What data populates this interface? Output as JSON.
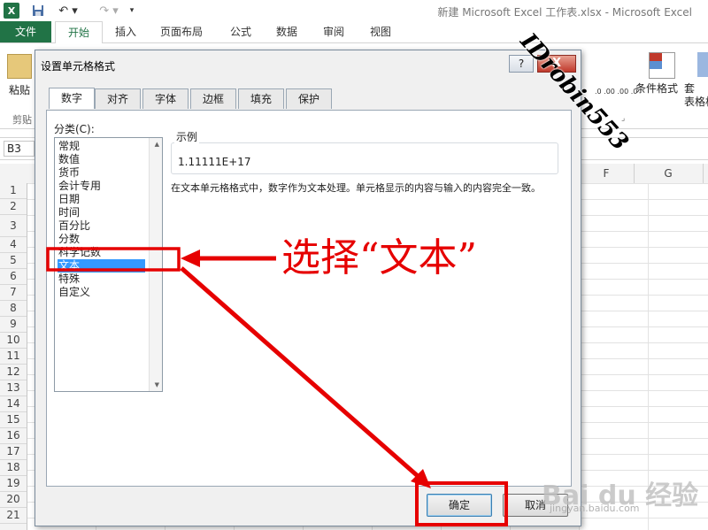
{
  "app": {
    "window_title": "新建 Microsoft Excel 工作表.xlsx - Microsoft Excel",
    "logo_text": "X"
  },
  "ribbon": {
    "tabs": [
      "文件",
      "开始",
      "插入",
      "页面布局",
      "公式",
      "数据",
      "审阅",
      "视图"
    ],
    "paste_label": "粘贴",
    "clipboard_label": "剪贴",
    "conditional_label": "条件格式",
    "table_label": "套",
    "table_format_label": "表格格",
    "number_mini": ".0 .00 .00 .0"
  },
  "sheet": {
    "name_box": "B3",
    "columns": [
      "F",
      "G"
    ],
    "rows": [
      "1",
      "2",
      "3",
      "4",
      "5",
      "6",
      "7",
      "8",
      "9",
      "10",
      "11",
      "12",
      "13",
      "14",
      "15",
      "16",
      "17",
      "18",
      "19",
      "20",
      "21"
    ]
  },
  "dialog": {
    "title": "设置单元格格式",
    "help_label": "?",
    "close_label": "X",
    "tabs": [
      "数字",
      "对齐",
      "字体",
      "边框",
      "填充",
      "保护"
    ],
    "active_tab": "数字",
    "category_label": "分类(C):",
    "categories": [
      "常规",
      "数值",
      "货币",
      "会计专用",
      "日期",
      "时间",
      "百分比",
      "分数",
      "科学记数",
      "文本",
      "特殊",
      "自定义"
    ],
    "selected_category": "文本",
    "sample_label": "示例",
    "sample_value": "1.11111E+17",
    "description": "在文本单元格格式中，数字作为文本处理。单元格显示的内容与输入的内容完全一致。",
    "ok_label": "确定",
    "cancel_label": "取消"
  },
  "annotation": {
    "text": "选择“文本”",
    "color": "#e60000"
  },
  "watermark": {
    "id_text": "IDrobin553",
    "logo": "Bai du 经验",
    "url": "jingyan.baidu.com"
  }
}
